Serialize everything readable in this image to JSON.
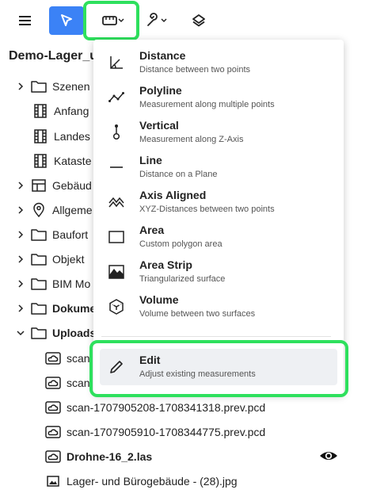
{
  "toolbar": {
    "menu": "menu-icon",
    "select": "pointer-icon",
    "measure": "ruler-icon",
    "tools": "wrench-icon",
    "layers": "layers-icon",
    "accent": "#3b82f6",
    "highlight": "#2ee05d"
  },
  "project": {
    "title": "Demo-Lager_u"
  },
  "tree": [
    {
      "label": "Szenen",
      "icon": "folder-icon",
      "chevron": true,
      "bold": false
    },
    {
      "label": "Anfang",
      "icon": "film-icon",
      "chevron": false,
      "bold": false
    },
    {
      "label": "Landes",
      "icon": "film-icon",
      "chevron": false,
      "bold": false
    },
    {
      "label": "Kataste",
      "icon": "film-icon",
      "chevron": false,
      "bold": false
    },
    {
      "label": "Gebäud",
      "icon": "table-icon",
      "chevron": true,
      "bold": false
    },
    {
      "label": "Allgeme",
      "icon": "pin-icon",
      "chevron": true,
      "bold": false
    },
    {
      "label": "Baufort",
      "icon": "folder-icon",
      "chevron": true,
      "bold": false
    },
    {
      "label": "Objekt",
      "icon": "folder-icon",
      "chevron": true,
      "bold": false
    },
    {
      "label": "BIM Mo",
      "icon": "folder-icon",
      "chevron": true,
      "bold": false
    },
    {
      "label": "Dokume",
      "icon": "folder-icon",
      "chevron": true,
      "bold": true
    },
    {
      "label": "Uploads",
      "icon": "folder-icon",
      "chevron": true,
      "bold": true,
      "expanded": true
    },
    {
      "label": "scan",
      "icon": "cloud-icon",
      "chevron": false,
      "bold": false
    },
    {
      "label": "scan",
      "icon": "cloud-icon",
      "chevron": false,
      "bold": false
    },
    {
      "label": "scan-1707905208-1708341318.prev.pcd",
      "icon": "cloud-icon",
      "chevron": false,
      "bold": false
    },
    {
      "label": "scan-1707905910-1708344775.prev.pcd",
      "icon": "cloud-icon",
      "chevron": false,
      "bold": false
    },
    {
      "label": "Drohne-16_2.las",
      "icon": "cloud-icon",
      "chevron": false,
      "bold": true
    },
    {
      "label": "Lager- und Bürogebäude -  (28).jpg",
      "icon": "image-icon",
      "chevron": false,
      "bold": false
    }
  ],
  "visibility": "eye-icon",
  "menu": {
    "items": [
      {
        "title": "Distance",
        "desc": "Distance between two points",
        "icon": "distance-icon"
      },
      {
        "title": "Polyline",
        "desc": "Measurement along multiple points",
        "icon": "polyline-icon"
      },
      {
        "title": "Vertical",
        "desc": "Measurement along Z-Axis",
        "icon": "vertical-icon"
      },
      {
        "title": "Line",
        "desc": "Distance on a Plane",
        "icon": "line-icon"
      },
      {
        "title": "Axis Aligned",
        "desc": "XYZ-Distances between two points",
        "icon": "axis-aligned-icon"
      },
      {
        "title": "Area",
        "desc": "Custom polygon area",
        "icon": "area-icon"
      },
      {
        "title": "Area Strip",
        "desc": "Triangularized surface",
        "icon": "area-strip-icon"
      },
      {
        "title": "Volume",
        "desc": "Volume between two surfaces",
        "icon": "volume-icon"
      }
    ],
    "edit": {
      "title": "Edit",
      "desc": "Adjust existing measurements",
      "icon": "pencil-icon"
    }
  }
}
